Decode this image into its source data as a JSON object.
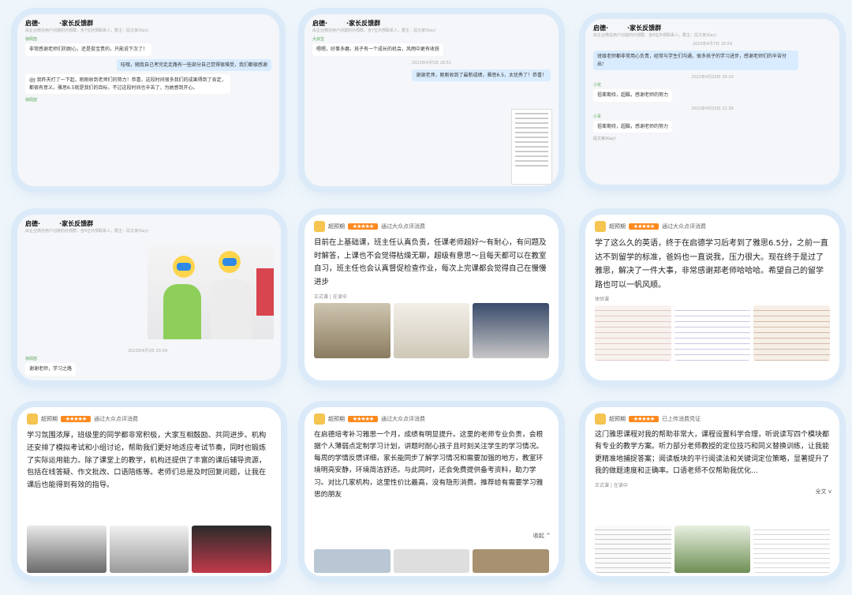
{
  "chat1": {
    "title": "启德·　　　·家长反馈群",
    "subtitle": "由企业微信用户创建的外部群，含7位外部联系人，群主：段文家(Kay)",
    "sender1": "徐佩喆",
    "msg1": "非常感谢老师们的耐心，还是挺宝贵的，只能说下次了！",
    "msg2": "哇哦，随我自己考完走走路有一些部分自己觉得很难受，我们都很感谢",
    "msg3": "@J 我昨天打了一下起，刚刚收到老师们的努力！恭喜，这段时间很多我们的成果得到了肯定，都很有意义，雅思6.5就是我们的目标，不过这段时间也辛苦了，为她感到开心。",
    "sender2": "徐佩喆"
  },
  "chat2": {
    "title": "启德·　　　·家长反馈群",
    "subtitle": "由企业微信用户创建的外部群，含7位外部联系人，群主：段文家(Kay)",
    "sender1": "大叔宝",
    "msg1": "嗯嗯，好事多磨，孩子有一个成长的机会，风雨中更有收获",
    "ts": "2023年4月5日 16:51",
    "msg2": "谢谢老师，刚刚收到了最新成绩，雅思6.5，太优秀了！恭喜！"
  },
  "chat3": {
    "title": "启德·　　　·家长反馈群",
    "subtitle": "由企业微信用户创建的外部群，含6位外部联系人，群主：段文家(Kay)",
    "ts1": "2023年4月7日 16:59",
    "msg1": "班级老师都非常用心负责，经常与学生们沟通，很多孩子的学习进步，感谢老师们的辛苦付出！",
    "ts2": "2023年4月20日 20:20",
    "sender1": "小花",
    "msg2": "祖辈期待，超酷，感谢老师的努力",
    "ts3": "2023年4月20日 22:38",
    "sender2": "小青",
    "msg3": "祖辈期待，超酷，感谢老师的努力",
    "sender3": "段文家(Kay)"
  },
  "chat4": {
    "title": "启德·　　　·家长反馈群",
    "subtitle": "由企业微信用户创建的外部群，含6位外部联系人，群主：段文家(Kay)",
    "ts": "2023年4月3日 20:34",
    "sender": "徐佩喆",
    "msg": "谢谢老师，学习之路"
  },
  "review1": {
    "user": "超预期",
    "source": "通过大众点评消费",
    "body": "目前在上基础课，班主任认真负责，任课老师超好～有耐心，有问题及时解答，上课也不会觉得枯燥无聊，超级有意思～且每天都可以在教室自习，班主任也会认真督促检查作业，每次上完课都会觉得自己在慢慢进步",
    "tag": "正式课 | 在读中"
  },
  "review2": {
    "user": "超预期",
    "source": "通过大众点评消费",
    "body": "学了这么久的英语，终于在启德学习后考到了雅思6.5分，之前一直达不到留学的标准，爸妈也一直说我，压力很大。现在终于是过了雅思，解决了一件大事，非常感谢郑老师哈哈哈。希望自己的留学路也可以一帆风顺。",
    "tag": "体验课"
  },
  "review3": {
    "user": "超预期",
    "source": "通过大众点评消费",
    "body": "学习氛围浓厚，班级里的同学都非常积极，大家互相鼓励、共同进步。机构还安排了模拟考试和小组讨论，帮助我们更好地适应考试节奏，同时也锻炼了实际运用能力。除了课堂上的教学，机构还提供了丰富的课后辅导资源，包括在线答疑、作文批改、口语陪练等。老师们总是及时回复问题，让我在课后也能得到有效的指导。"
  },
  "review4": {
    "user": "超预期",
    "source": "通过大众点评消费",
    "body": "在启德培考补习雅思一个月，成绩有明显提升。这里的老师专业负责，会根据个人薄弱点定制学习计划，讲题时耐心孩子且时刻关注学生的学习情况。每周的学情反馈详细，家长能同步了解学习情况和需要加强的地方，教室环境明亮安静，环境简洁舒适。与此同时，还会免费提供备考资料，助力学习。对比几家机构，这里性价比最高，没有隐形消费。推荐给有需要学习雅思的朋友",
    "collapse": "收起"
  },
  "review5": {
    "user": "超预期",
    "source": "已上传消费凭证",
    "body": "这门雅思课程对我的帮助非常大，课程设置科学合理，听说读写四个模块都有专业的教学方案。听力部分老师教授的定位技巧和同义替换训练，让我能更精准地捕捉答案；阅读板块的平行阅读法和关键词定位策略，显著提升了我的做题速度和正确率。口语老师不仅帮助我优化...",
    "expand": "全文",
    "tag": "正式课 | 在读中"
  },
  "colors": {
    "accent": "#2e8ae6",
    "star": "#ff8a1f",
    "bubble": "#d9ecff"
  }
}
